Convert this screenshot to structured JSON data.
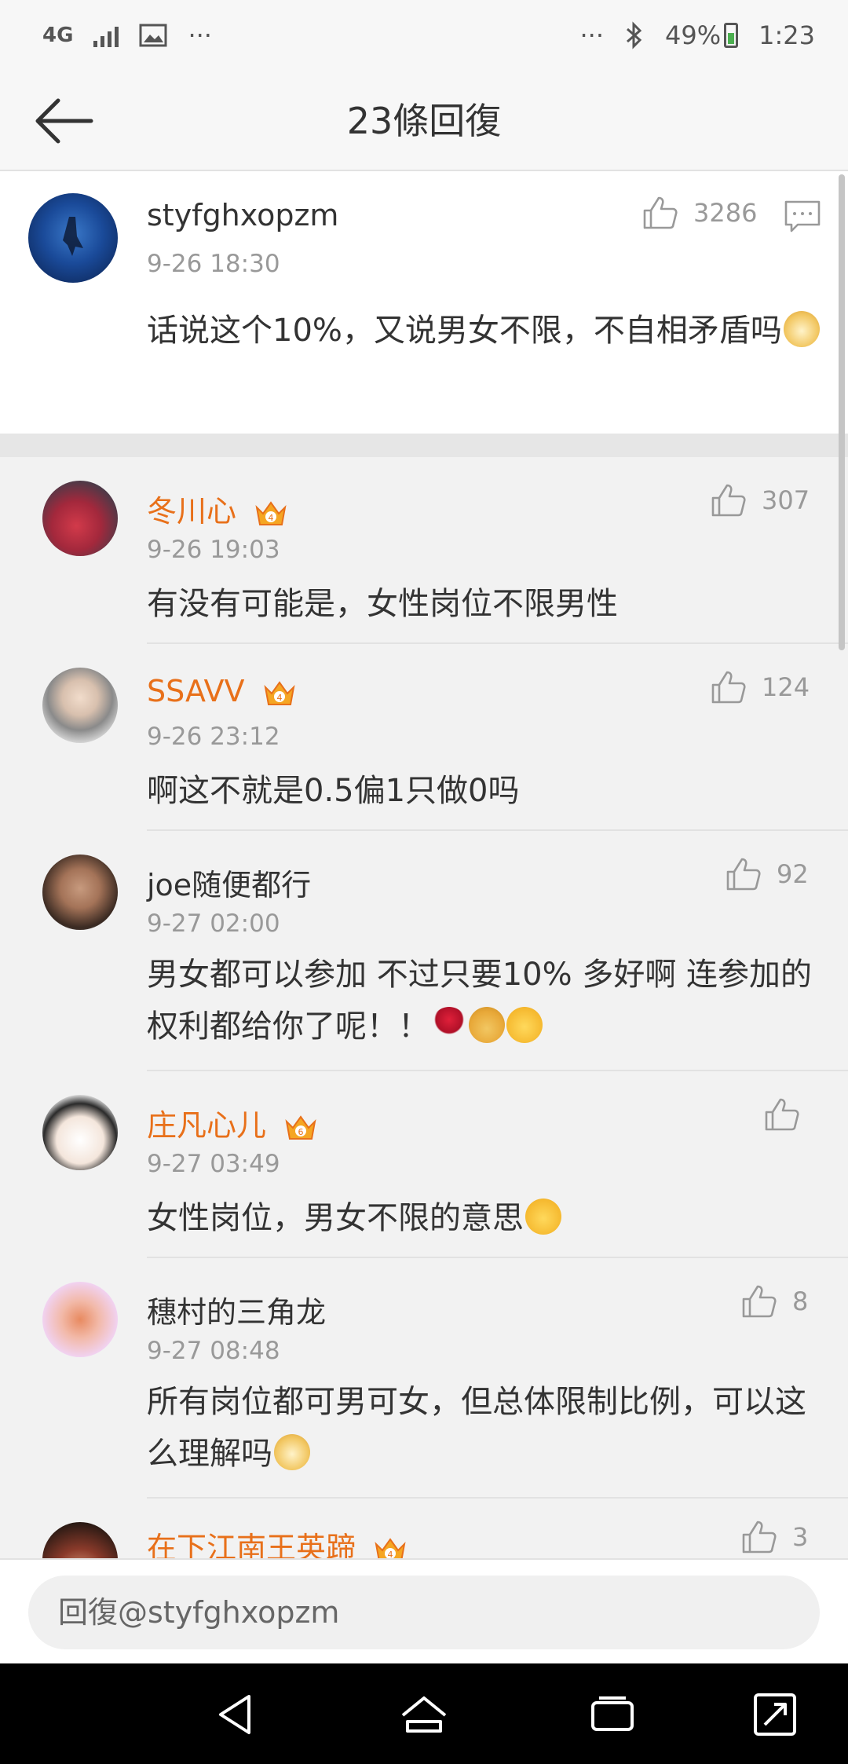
{
  "status_bar": {
    "network": "4G",
    "overflow": "···",
    "right_overflow": "···",
    "battery": "49%",
    "time": "1:23"
  },
  "header": {
    "title": "23條回復"
  },
  "main_comment": {
    "username": "styfghxopzm",
    "time": "9-26 18:30",
    "likes": "3286",
    "content": "话说这个10%，又说男女不限，不自相矛盾吗"
  },
  "replies": [
    {
      "username": "冬川心",
      "vip": true,
      "crown_level": "4",
      "time": "9-26 19:03",
      "likes": "307",
      "content": "有没有可能是，女性岗位不限男性"
    },
    {
      "username": "SSAVV",
      "vip": true,
      "crown_level": "4",
      "time": "9-26 23:12",
      "likes": "124",
      "content": "啊这不就是0.5偏1只做0吗"
    },
    {
      "username": "joe随便都行",
      "vip": false,
      "time": "9-27 02:00",
      "likes": "92",
      "content": "男女都可以参加 不过只要10% 多好啊 连参加的权利都给你了呢！！"
    },
    {
      "username": "庄凡心儿",
      "vip": true,
      "crown_level": "6",
      "time": "9-27 03:49",
      "likes": "",
      "content": "女性岗位，男女不限的意思"
    },
    {
      "username": "穗村的三角龙",
      "vip": false,
      "time": "9-27 08:48",
      "likes": "8",
      "content": "所有岗位都可男可女，但总体限制比例，可以这么理解吗"
    },
    {
      "username": "在下江南王英蹄",
      "vip": true,
      "crown_level": "4",
      "time": "",
      "likes": "3",
      "content": ""
    }
  ],
  "input": {
    "placeholder": "回復@styfghxopzm"
  },
  "colors": {
    "vip_name": "#e8701a",
    "meta_text": "#999999",
    "battery_fill": "#4caf50"
  },
  "icons": [
    "back-arrow-icon",
    "like-icon",
    "comment-icon",
    "crown-icon",
    "doge-emoji-icon",
    "rose-emoji-icon",
    "nav-back-icon",
    "nav-home-icon",
    "nav-recents-icon",
    "nav-expand-icon"
  ]
}
